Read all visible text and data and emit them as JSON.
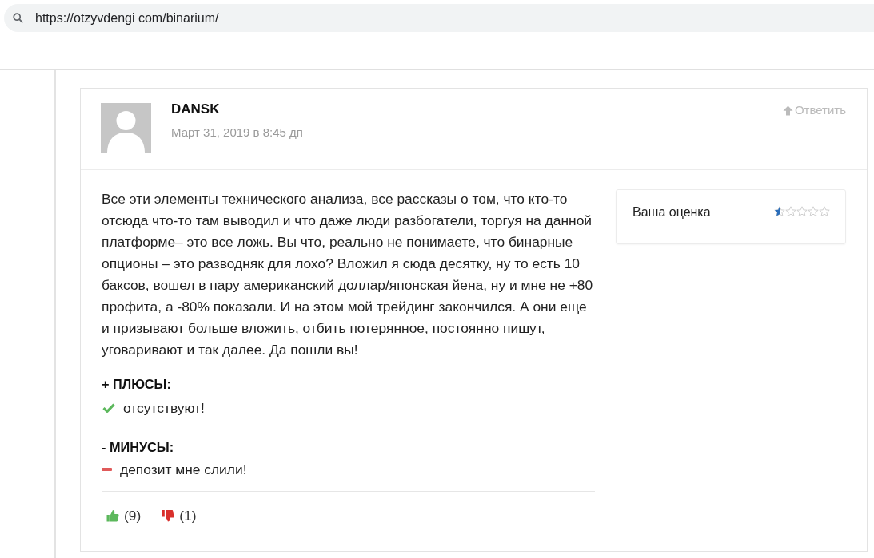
{
  "browser": {
    "url": "https://otzyvdengi com/binarium/"
  },
  "comment": {
    "author": "DANSK",
    "date": "Март 31, 2019 в 8:45 дп",
    "reply": "Ответить",
    "text": "Все эти элементы технического анализа, все рассказы о том, что кто-то отсюда что-то там выводил и что даже люди разбогатели, торгуя на данной платформе– это все ложь. Вы что, реально не понимаете, что бинарные опционы – это разводняк для лохо? Вложил я сюда десятку, ну то есть 10 баксов, вошел в пару американский доллар/японская йена, ну и мне не +80 профита, а -80% показали. И на этом мой трейдинг закончился. А они еще и призывают больше вложить, отбить потерянное, постоянно пишут, уговаривают и так далее. Да пошли вы!",
    "rating": {
      "label": "Ваша оценка",
      "stars": 0.5
    },
    "sections": [
      {
        "kind": "pros",
        "title": "+ ПЛЮСЫ:",
        "items": [
          "отсутствуют!"
        ]
      },
      {
        "kind": "cons",
        "title": "- МИНУСЫ:",
        "items": [
          "депозит мне слили!"
        ]
      }
    ],
    "votes": [
      {
        "kind": "up",
        "count": "(9)"
      },
      {
        "kind": "down",
        "count": "(1)"
      }
    ]
  }
}
